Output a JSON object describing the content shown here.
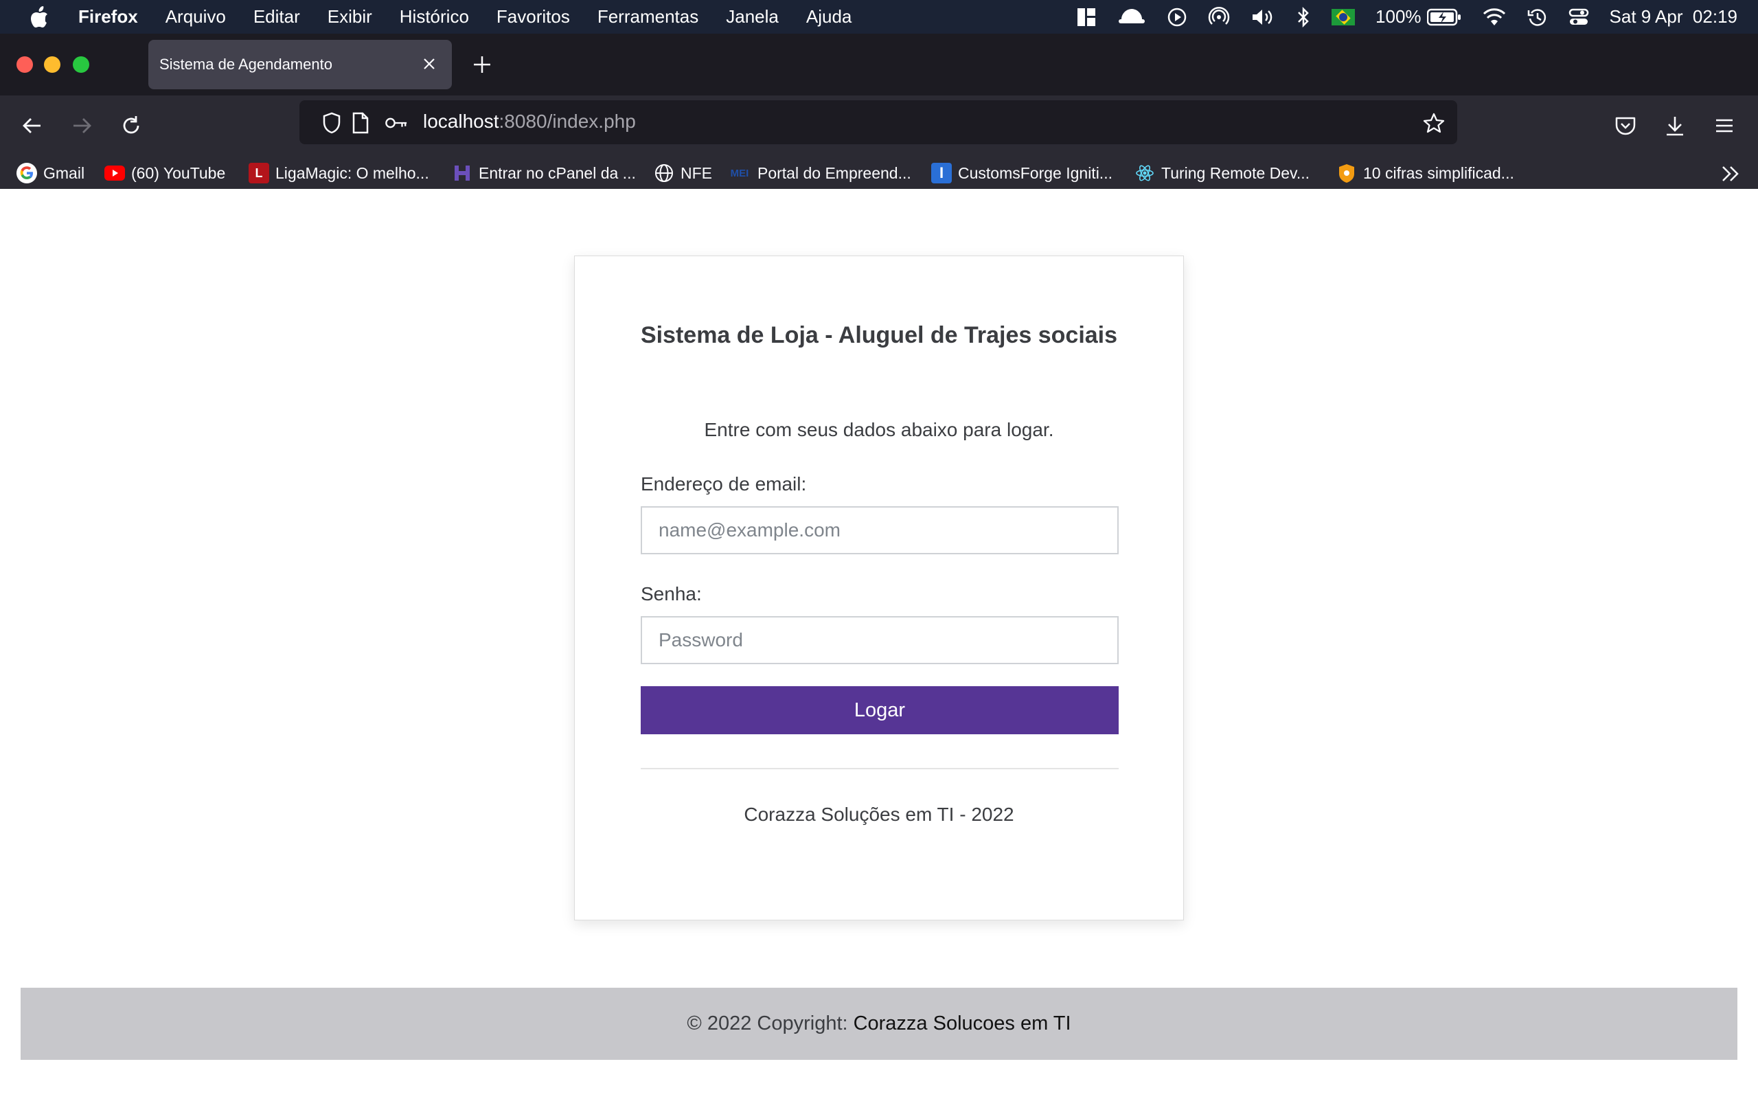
{
  "menubar": {
    "app_name": "Firefox",
    "items": [
      "Arquivo",
      "Editar",
      "Exibir",
      "Histórico",
      "Favoritos",
      "Ferramentas",
      "Janela",
      "Ajuda"
    ],
    "battery": "100%",
    "datetime": "Sat 9 Apr  02:19"
  },
  "browser": {
    "tab_title": "Sistema de Agendamento",
    "url_host": "localhost",
    "url_rest": ":8080/index.php",
    "bookmarks": [
      {
        "label": "Gmail",
        "icon": "google-icon"
      },
      {
        "label": "(60) YouTube",
        "icon": "youtube-icon"
      },
      {
        "label": "LigaMagic: O melho...",
        "icon": "ligamagic-icon"
      },
      {
        "label": "Entrar no cPanel da ...",
        "icon": "hostgator-icon"
      },
      {
        "label": "NFE",
        "icon": "globe-icon"
      },
      {
        "label": "Portal do Empreend...",
        "icon": "mei-icon"
      },
      {
        "label": "CustomsForge Igniti...",
        "icon": "customsforge-icon"
      },
      {
        "label": "Turing Remote Dev...",
        "icon": "react-icon"
      },
      {
        "label": "10 cifras simplificad...",
        "icon": "cifras-icon"
      }
    ]
  },
  "login": {
    "title": "Sistema de Loja - Aluguel de Trajes sociais",
    "subtitle": "Entre com seus dados abaixo para logar.",
    "email_label": "Endereço de email:",
    "email_placeholder": "name@example.com",
    "email_value": "",
    "password_label": "Senha:",
    "password_placeholder": "Password",
    "password_value": "",
    "button_label": "Logar",
    "card_footer": "Corazza Soluções em TI - 2022"
  },
  "footer": {
    "copyright": "© 2022 Copyright:",
    "company": "Corazza Solucoes em TI"
  },
  "colors": {
    "accent": "#563595",
    "menubar": "#1b2335",
    "footer_bg": "#c7c7cb"
  }
}
